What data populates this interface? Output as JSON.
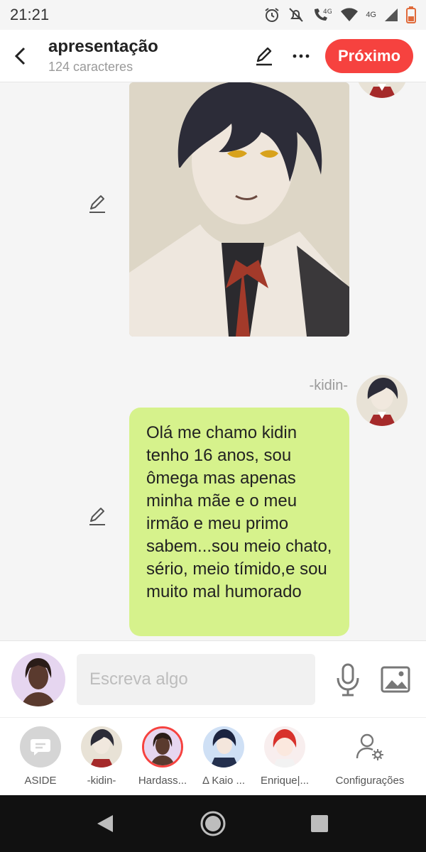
{
  "status_bar": {
    "time": "21:21",
    "network_label": "4G",
    "icons": [
      "alarm-icon",
      "mute-icon",
      "call-4g-icon",
      "wifi-icon",
      "signal-icon",
      "battery-icon"
    ]
  },
  "header": {
    "title": "apresentação",
    "subtitle": "124 caracteres",
    "next_label": "Próximo",
    "accent_color": "#f6423f"
  },
  "chat": {
    "image_message": {
      "type": "character-illustration"
    },
    "text_message": {
      "sender": "-kidin-",
      "text": "Olá me chamo kidin tenho 16 anos, sou ômega mas apenas minha mãe e o meu irmão e meu primo sabem...sou meio chato, sério, meio tímido,e sou muito mal humorado",
      "bubble_color": "#d6f28c"
    }
  },
  "composer": {
    "placeholder": "Escreva algo"
  },
  "characters": [
    {
      "label": "ASIDE",
      "icon": "aside-chat-icon"
    },
    {
      "label": "-kidin-"
    },
    {
      "label": "Hardass..."
    },
    {
      "label": "Δ Kaio ..."
    },
    {
      "label": "Enrique|..."
    },
    {
      "label": "Configurações",
      "icon": "user-settings-icon"
    }
  ]
}
